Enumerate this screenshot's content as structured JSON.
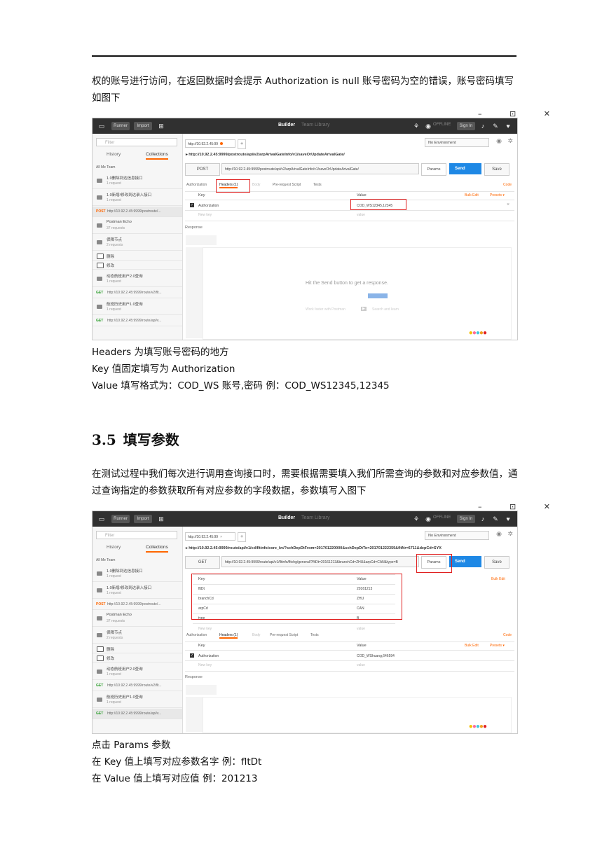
{
  "intro_paragraph": "权的账号进行访问，在返回数据时会提示 Authorization is null 账号密码为空的错误，账号密码填写如图下",
  "window_controls": "– ⊡ ✕",
  "postman_common": {
    "runner": "Runner",
    "import": "Import",
    "builder": "Builder",
    "team_library": "Team Library",
    "offline": "OFFLINE",
    "sign_in": "Sign In",
    "filter_placeholder": "Filter",
    "tab_history": "History",
    "tab_collections": "Collections",
    "filter_row": "All  Me  Team",
    "environment": "No Environment",
    "params": "Params",
    "send": "Send",
    "save": "Save",
    "code": "Code",
    "bulk_edit": "Bulk Edit",
    "presets": "Presets ▾",
    "key": "Key",
    "value": "Value",
    "new_key": "New key",
    "value_ph": "value",
    "response": "Response",
    "tab_authorization": "Authorization",
    "tab_headers": "Headers (1)",
    "tab_body": "Body",
    "tab_prerequest": "Pre-request Script",
    "tab_tests": "Tests",
    "sidebar": [
      {
        "title": "1.0删除到达信息接口",
        "sub": "1 request"
      },
      {
        "title": "1.0新增/修改到达录入接口",
        "sub": "1 request"
      },
      {
        "method": "POST",
        "url": "http://10.92.2.45:9999/postroute/..."
      },
      {
        "title": "Postman Echo",
        "sub": "37 requests"
      },
      {
        "title": "保障节点",
        "sub": "2 requests"
      },
      {
        "title": "删除"
      },
      {
        "title": "修改"
      },
      {
        "title": "动态航班用户2.0查询",
        "sub": "1 request"
      },
      {
        "method": "GET",
        "url": "http://10.92.2.45:9999/route/v2/flt..."
      },
      {
        "title": "航班历史用户1.0查询",
        "sub": "1 request"
      },
      {
        "method": "GET",
        "url": "http://10.92.2.45:9999/route/api/v..."
      }
    ]
  },
  "screenshot1": {
    "tab_label": "http://10.92.2.45:99",
    "crumb": "▸ http://10.92.2.45:9999/postroute/api/v2/arpArivalGateInfo/v1/saveOrUpdateArivalGate/",
    "method": "POST",
    "url": "http://10.92.2.45:9999/postroute/api/v2/arpArivalGateInfo/v1/saveOrUpdateArivalGate/",
    "header_key": "Authorization",
    "header_value": "COD_WS12345,12345",
    "hit_send": "Hit the Send button to get a response.",
    "work_faster": "Work faster with Postman",
    "search_learn": "Search and learn"
  },
  "caption1": [
    "Headers 为填写账号密码的地方",
    "Key 值固定填写为  Authorization",
    "Value  填写格式为：COD_WS 账号,密码  例：COD_WS12345,12345"
  ],
  "section": {
    "number": "3.5",
    "title": "填写参数"
  },
  "para2": "在测试过程中我们每次进行调用查询接口时，需要根据需要填入我们所需查询的参数和对应参数值，通过查询指定的参数获取所有对应参数的字段数据，参数填写入图下",
  "screenshot2": {
    "tab_label": "http://10.92.2.45:99",
    "crumb": "▸ http://10.92.2.45:9999/route/api/v1/cd/fltinfo/core_kv/?schDepDtFrom=201701220000&schDepDtTo=201701222359&fltNr=6711&depCd=SYX",
    "method": "GET",
    "url": "http://10.92.2.45:9999/route/api/v1/fltinfo/fltchg/general/?fltDt=20161213&branchCd=ZHU&arpCd=CAN&type=B",
    "params": [
      {
        "key": "fltDt",
        "value": "20161213"
      },
      {
        "key": "branchCd",
        "value": "ZHU"
      },
      {
        "key": "arpCd",
        "value": "CAN"
      },
      {
        "key": "type",
        "value": "B"
      }
    ],
    "header_key": "Authorization",
    "header_value": "COD_WShuang,646594"
  },
  "caption2": [
    "点击 Params 参数",
    "在 Key 值上填写对应参数名字  例：fltDt",
    "在 Value 值上填写对应值       例：201213"
  ]
}
